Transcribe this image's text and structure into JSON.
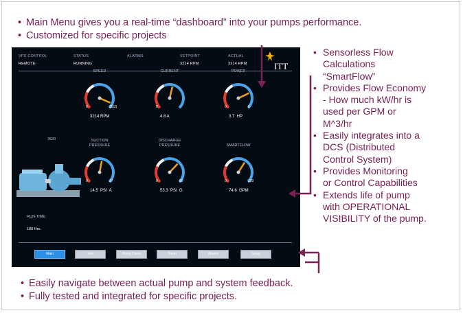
{
  "top_bullets": [
    "Main Menu gives you a real-time “dashboard” into your pumps performance.",
    "Customized for specific projects"
  ],
  "side_bullets": [
    "Sensorless Flow\nCalculations\n“SmartFlow”",
    "Provides Flow Economy\n- How much kW/hr is\nused per GPM or\nM^3/hr",
    "Easily integrates into a\nDCS (Distributed\nControl System)",
    "Provides Monitoring\nor Control Capabilities",
    "Extends life of pump\nwith OPERATIONAL\nVISIBILITY of the pump."
  ],
  "bottom_bullets": [
    "Easily navigate between actual pump and system feedback.",
    "Fully tested and integrated for specific projects."
  ],
  "bullet_glyph": "•",
  "colors": {
    "bullet_text": "#7a2155",
    "connector": "#7a2155",
    "screen_bg": "#050b12",
    "gauge_needle": "#f0a020",
    "active_button": "#2c8fe6"
  },
  "hmi": {
    "header": {
      "vfd_control_label": "VFD CONTROL",
      "vfd_control_value": "REMOTE",
      "status_label": "STATUS",
      "status_value": "RUNNING",
      "alarms_label": "ALARMS",
      "setpoint_label": "SETPOINT",
      "setpoint_value": "3214 RPM",
      "actual_label": "ACTUAL",
      "actual_value": "3214 RPM",
      "logo": "ITT"
    },
    "pump_id": "3620",
    "runtime_label": "RUN-TIME",
    "runtime_value": "180 Hrs.",
    "gauges": [
      {
        "label": "SPEED",
        "min": "0",
        "max": "3510",
        "readout": "3214 RPM"
      },
      {
        "label": "CURRENT",
        "min": "0",
        "max": "",
        "readout": "4.8 A"
      },
      {
        "label": "POWER",
        "min": "0",
        "max": "5",
        "readout": "3.7  HP"
      },
      {
        "label": "SUCTION\nPRESSURE",
        "min": "0",
        "max": "27",
        "readout": "14.5  PSI  A"
      },
      {
        "label": "DISCHARGE\nPRESSURE",
        "min": "0",
        "max": "80",
        "readout": "53.3  PSI  G"
      },
      {
        "label": "SMARTFLOW",
        "min": "0",
        "max": "120",
        "readout": "74.6  GPM"
      }
    ],
    "nav_buttons": [
      {
        "label": "Main",
        "active": true
      },
      {
        "label": "Info",
        "active": false
      },
      {
        "label": "Pump Curve",
        "active": false
      },
      {
        "label": "Trend",
        "active": false
      },
      {
        "label": "Alarms",
        "active": false
      },
      {
        "label": "Setup",
        "active": false
      }
    ]
  }
}
